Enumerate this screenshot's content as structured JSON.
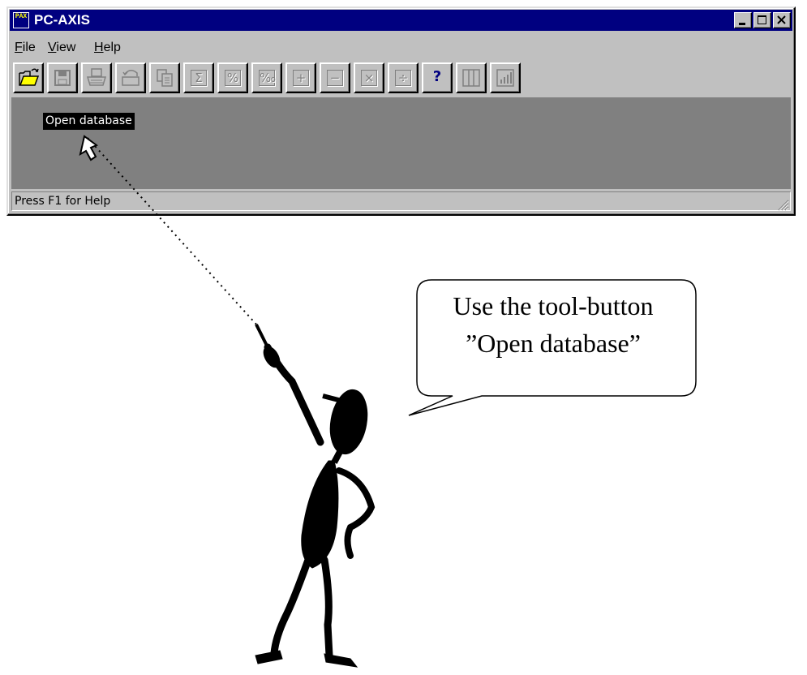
{
  "window": {
    "title": "PC-AXIS",
    "app_icon_text": "PAX",
    "controls": {
      "minimize": "minimize-icon",
      "maximize": "maximize-icon",
      "close": "close-icon"
    }
  },
  "menu": [
    {
      "label": "File",
      "mnemonic": "F",
      "rest": "ile"
    },
    {
      "label": "View",
      "mnemonic": "V",
      "rest": "iew"
    },
    {
      "label": "Help",
      "mnemonic": "H",
      "rest": "elp"
    }
  ],
  "toolbar": {
    "buttons": [
      {
        "name": "open-database-icon",
        "glyph": "",
        "enabled": true
      },
      {
        "name": "save-icon",
        "glyph": "",
        "enabled": false
      },
      {
        "name": "print-icon",
        "glyph": "",
        "enabled": false
      },
      {
        "name": "undo-icon",
        "glyph": "",
        "enabled": false
      },
      {
        "name": "copy-icon",
        "glyph": "",
        "enabled": false
      },
      {
        "name": "sum-icon",
        "glyph": "Σ",
        "enabled": false
      },
      {
        "name": "percent-icon",
        "glyph": "%",
        "enabled": false
      },
      {
        "name": "per-mille-icon",
        "glyph": "‰",
        "enabled": false
      },
      {
        "name": "add-icon",
        "glyph": "+",
        "enabled": false
      },
      {
        "name": "subtract-icon",
        "glyph": "−",
        "enabled": false
      },
      {
        "name": "multiply-icon",
        "glyph": "×",
        "enabled": false
      },
      {
        "name": "divide-icon",
        "glyph": "÷",
        "enabled": false
      },
      {
        "name": "help-icon",
        "glyph": "?",
        "enabled": true
      },
      {
        "name": "pivot-icon",
        "glyph": "",
        "enabled": false
      },
      {
        "name": "chart-icon",
        "glyph": "",
        "enabled": false
      }
    ]
  },
  "tooltip": "Open database",
  "status": "Press F1 for Help",
  "callout": {
    "line1": "Use the tool-button",
    "line2": "”Open database”"
  },
  "colors": {
    "titlebar": "#000080",
    "face": "#c0c0c0",
    "client": "#808080"
  }
}
